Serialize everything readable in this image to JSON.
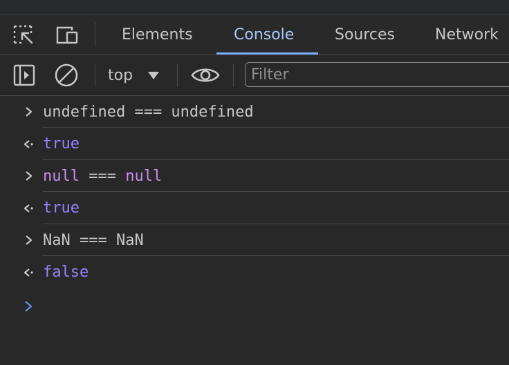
{
  "tabs": [
    {
      "label": "Elements"
    },
    {
      "label": "Console"
    },
    {
      "label": "Sources"
    },
    {
      "label": "Network"
    }
  ],
  "toolbar": {
    "context": "top",
    "filter_placeholder": "Filter"
  },
  "icons": {
    "inspect": "inspect-element-icon",
    "device": "device-toolbar-icon",
    "sidebar": "console-sidebar-icon",
    "clear": "clear-console-icon",
    "eye": "live-expression-icon",
    "input_marker": "chevron-right-icon",
    "result_marker": "result-arrow-icon"
  },
  "colors": {
    "active_tab": "#a8c7fa",
    "keyword": "#c68cf0",
    "result": "#9980ff",
    "text": "#c7c7c7",
    "prompt": "#5e8ee0"
  },
  "console": {
    "entries": [
      {
        "type": "input",
        "parts": [
          {
            "text": "undefined === undefined",
            "style": "text"
          }
        ]
      },
      {
        "type": "result",
        "parts": [
          {
            "text": "true",
            "style": "result"
          }
        ]
      },
      {
        "type": "input",
        "parts": [
          {
            "text": "null",
            "style": "kw"
          },
          {
            "text": " === ",
            "style": "text"
          },
          {
            "text": "null",
            "style": "kw"
          }
        ]
      },
      {
        "type": "result",
        "parts": [
          {
            "text": "true",
            "style": "result"
          }
        ]
      },
      {
        "type": "input",
        "parts": [
          {
            "text": "NaN === NaN",
            "style": "text"
          }
        ]
      },
      {
        "type": "result",
        "parts": [
          {
            "text": "false",
            "style": "result"
          }
        ]
      }
    ]
  }
}
